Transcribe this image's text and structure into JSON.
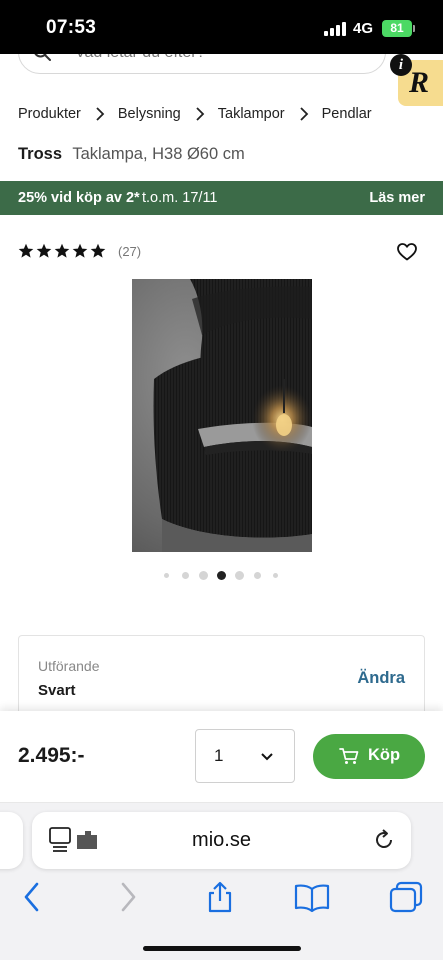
{
  "status_bar": {
    "time": "07:53",
    "network": "4G",
    "battery": "81",
    "signal_icon": "signal-bars-icon",
    "battery_icon": "battery-charging-icon"
  },
  "search": {
    "placeholder": "Vad letar du efter?"
  },
  "badge": {
    "info_letter": "i",
    "letter": "R"
  },
  "breadcrumb": [
    "Produkter",
    "Belysning",
    "Taklampor",
    "Pendlar"
  ],
  "product": {
    "brand": "Tross",
    "description": "Taklampa, H38 Ø60 cm",
    "rating_count": "(27)",
    "rating": 5,
    "rating_max": 5,
    "image": {
      "subject": "black fringe double-tier pendant lamp with lit bulb"
    }
  },
  "promo": {
    "text": "25% vid köp av 2*",
    "date": "t.o.m. 17/11",
    "link": "Läs mer",
    "color": "#3c6b48"
  },
  "gallery": {
    "dot_count": 7,
    "active_index": 3
  },
  "variant": {
    "label": "Utförande",
    "value": "Svart",
    "change_label": "Ändra",
    "link_color": "#2e6a8e"
  },
  "purchase": {
    "price": "2.495:-",
    "quantity": "1",
    "buy_label": "Köp",
    "buy_color": "#4aa843"
  },
  "browser": {
    "url": "mio.se",
    "icons": [
      "back-icon",
      "forward-icon",
      "share-icon",
      "bookmarks-icon",
      "tabs-icon",
      "reload-icon",
      "reader-mode-icon"
    ]
  }
}
